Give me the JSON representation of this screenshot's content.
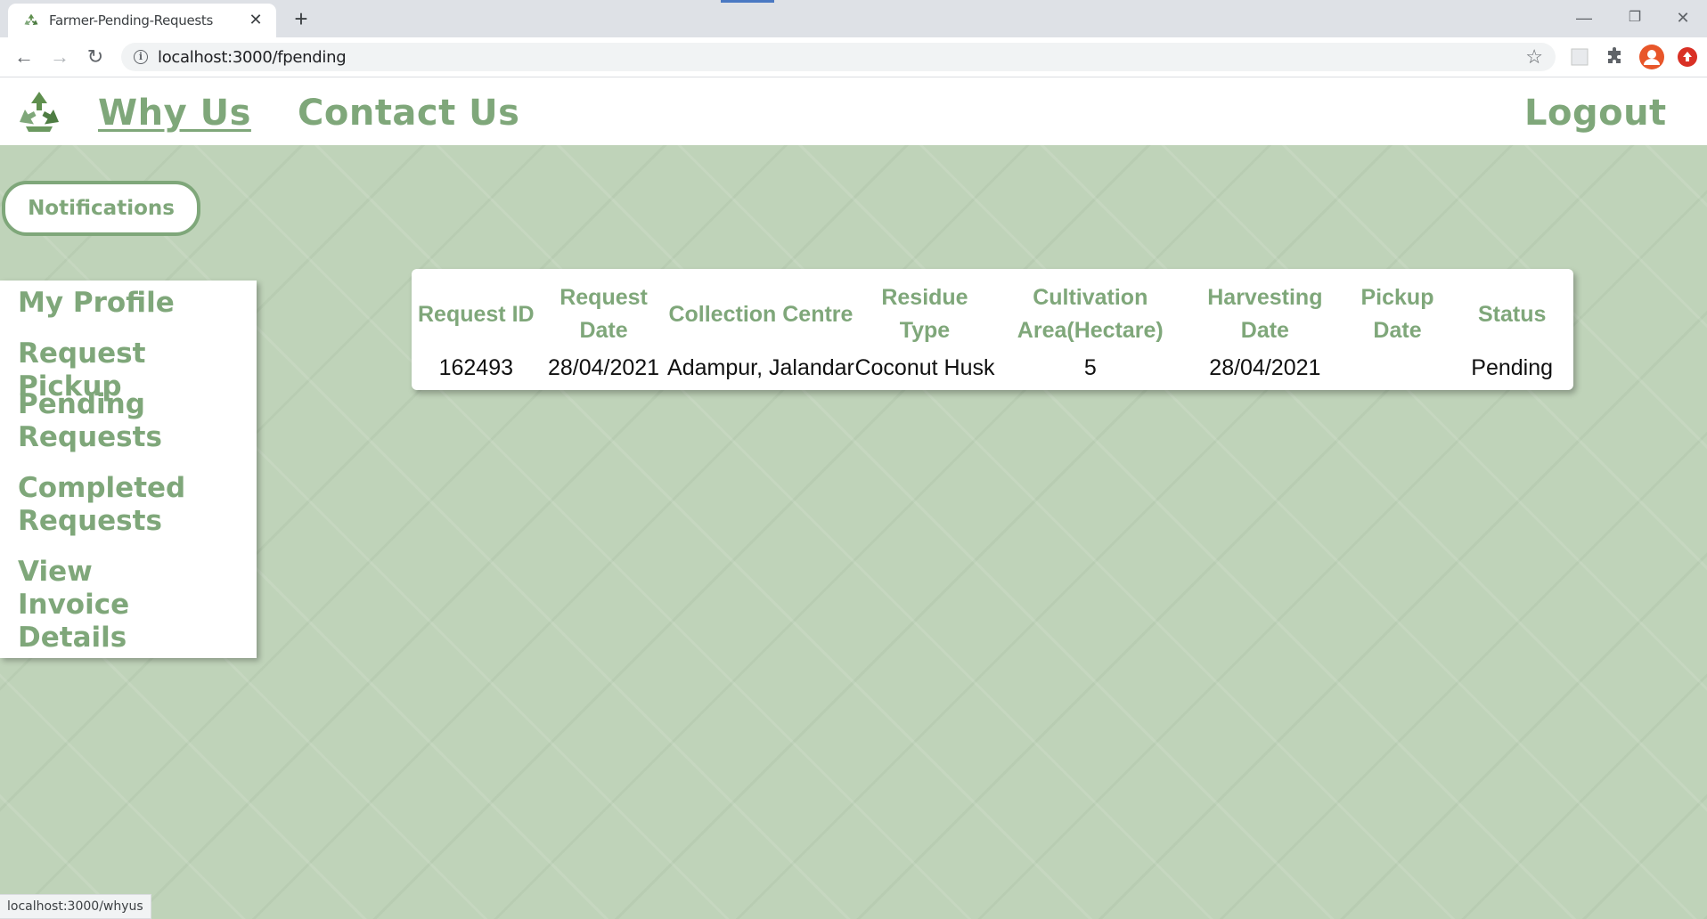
{
  "browser": {
    "tab_title": "Farmer-Pending-Requests",
    "tab_close": "✕",
    "new_tab": "+",
    "url": "localhost:3000/fpending",
    "window_controls": {
      "minimize": "—",
      "restore": "❐",
      "close": "✕"
    },
    "nav": {
      "back": "←",
      "forward": "→",
      "reload": "↻"
    },
    "bookmark_star": "☆",
    "status_url": "localhost:3000/whyus"
  },
  "header": {
    "logo_icon": "recycle-icon",
    "nav": {
      "why_us": "Why Us",
      "contact_us": "Contact Us",
      "logout": "Logout"
    }
  },
  "notifications_button": "Notifications",
  "sidebar": {
    "items": [
      {
        "label": "My Profile"
      },
      {
        "label": "Request Pickup"
      },
      {
        "label": "Pending Requests"
      },
      {
        "label": "Completed Requests"
      },
      {
        "label": "View Invoice Details"
      }
    ]
  },
  "requests_table": {
    "headers": [
      "Request ID",
      "Request Date",
      "Collection Centre",
      "Residue Type",
      "Cultivation Area(Hectare)",
      "Harvesting Date",
      "Pickup Date",
      "Status"
    ],
    "rows": [
      [
        "162493",
        "28/04/2021",
        "Adampur, Jalandar",
        "Coconut Husk",
        "5",
        "28/04/2021",
        "",
        "Pending"
      ]
    ]
  },
  "colors": {
    "accent": "#7fa77a",
    "page_bg": "#bfd3b9"
  }
}
